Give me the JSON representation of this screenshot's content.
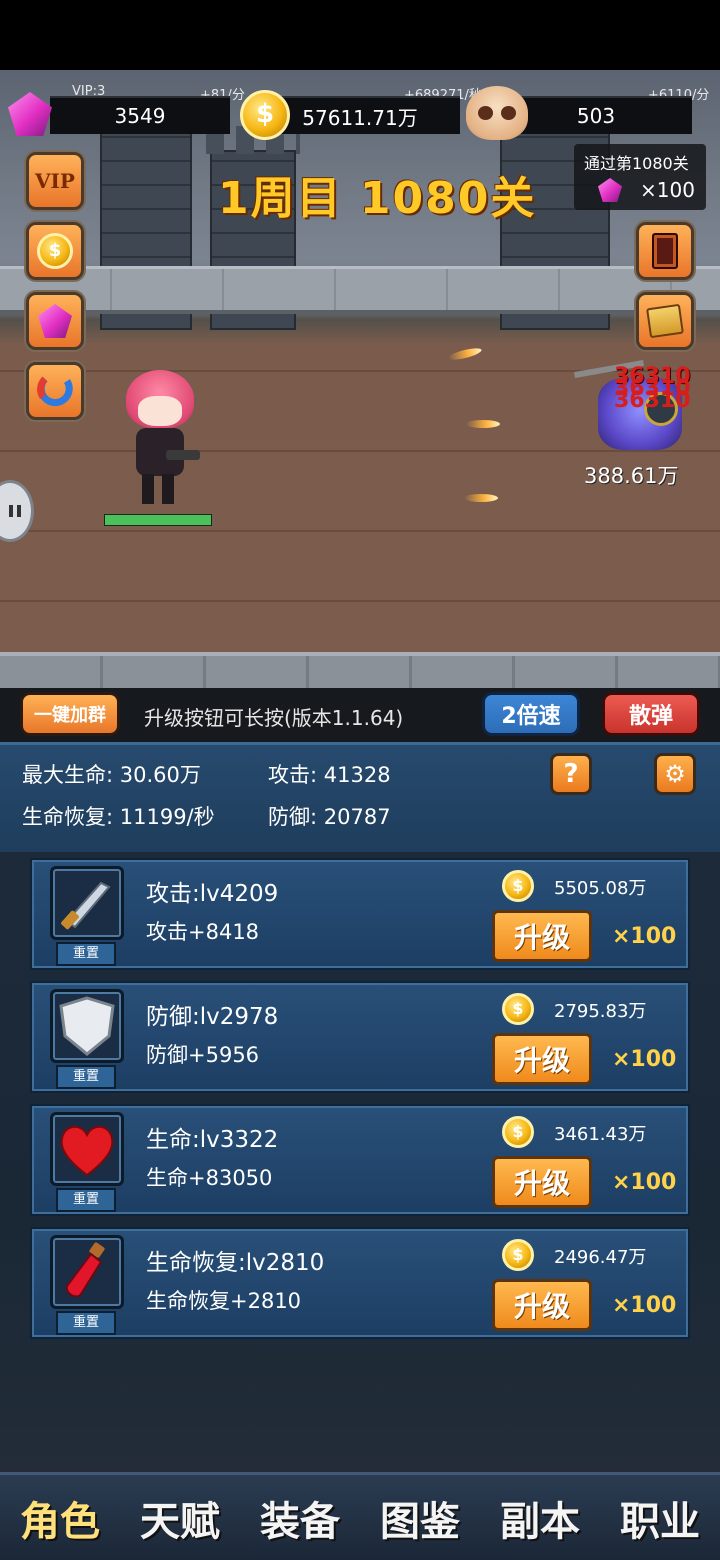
{
  "resources": {
    "vip": "VIP:3",
    "gems": "3549",
    "gems_rate": "+81/分",
    "gold": "57611.71万",
    "gold_rate": "+689271/秒",
    "skulls": "503",
    "skulls_rate": "+6110/分"
  },
  "stage": {
    "title": "1周目 1080关",
    "reward_label": "通过第1080关",
    "reward_amount": "×100"
  },
  "side_buttons": {
    "vip": "VIP",
    "coin": "$"
  },
  "enemy": {
    "damage_text": "36310",
    "hp": "388.61万"
  },
  "player": {
    "health_fraction": 1.0
  },
  "notice": {
    "join_group": "一键加群",
    "text": "升级按钮可长按(版本1.1.64)",
    "speed": "2倍速",
    "bullet": "散弹"
  },
  "stats": {
    "max_hp": "最大生命: 30.60万",
    "attack": "攻击: 41328",
    "regen": "生命恢复: 11199/秒",
    "defense": "防御: 20787",
    "help": "?",
    "settings": "⚙"
  },
  "upgrades": [
    {
      "title": "攻击:lv4209",
      "effect": "攻击+8418",
      "cost": "5505.08万",
      "button": "升级",
      "mult": "×100",
      "reset": "重置"
    },
    {
      "title": "防御:lv2978",
      "effect": "防御+5956",
      "cost": "2795.83万",
      "button": "升级",
      "mult": "×100",
      "reset": "重置"
    },
    {
      "title": "生命:lv3322",
      "effect": "生命+83050",
      "cost": "3461.43万",
      "button": "升级",
      "mult": "×100",
      "reset": "重置"
    },
    {
      "title": "生命恢复:lv2810",
      "effect": "生命恢复+2810",
      "cost": "2496.47万",
      "button": "升级",
      "mult": "×100",
      "reset": "重置"
    }
  ],
  "nav": [
    "角色",
    "天赋",
    "装备",
    "图鉴",
    "副本",
    "职业"
  ],
  "colors": {
    "gold_text": "#ffc928",
    "upgrade_button": "#ef8a1d",
    "panel_blue": "#1d3e63",
    "speed_button": "#2d6db7",
    "bullet_button": "#d9453f"
  }
}
